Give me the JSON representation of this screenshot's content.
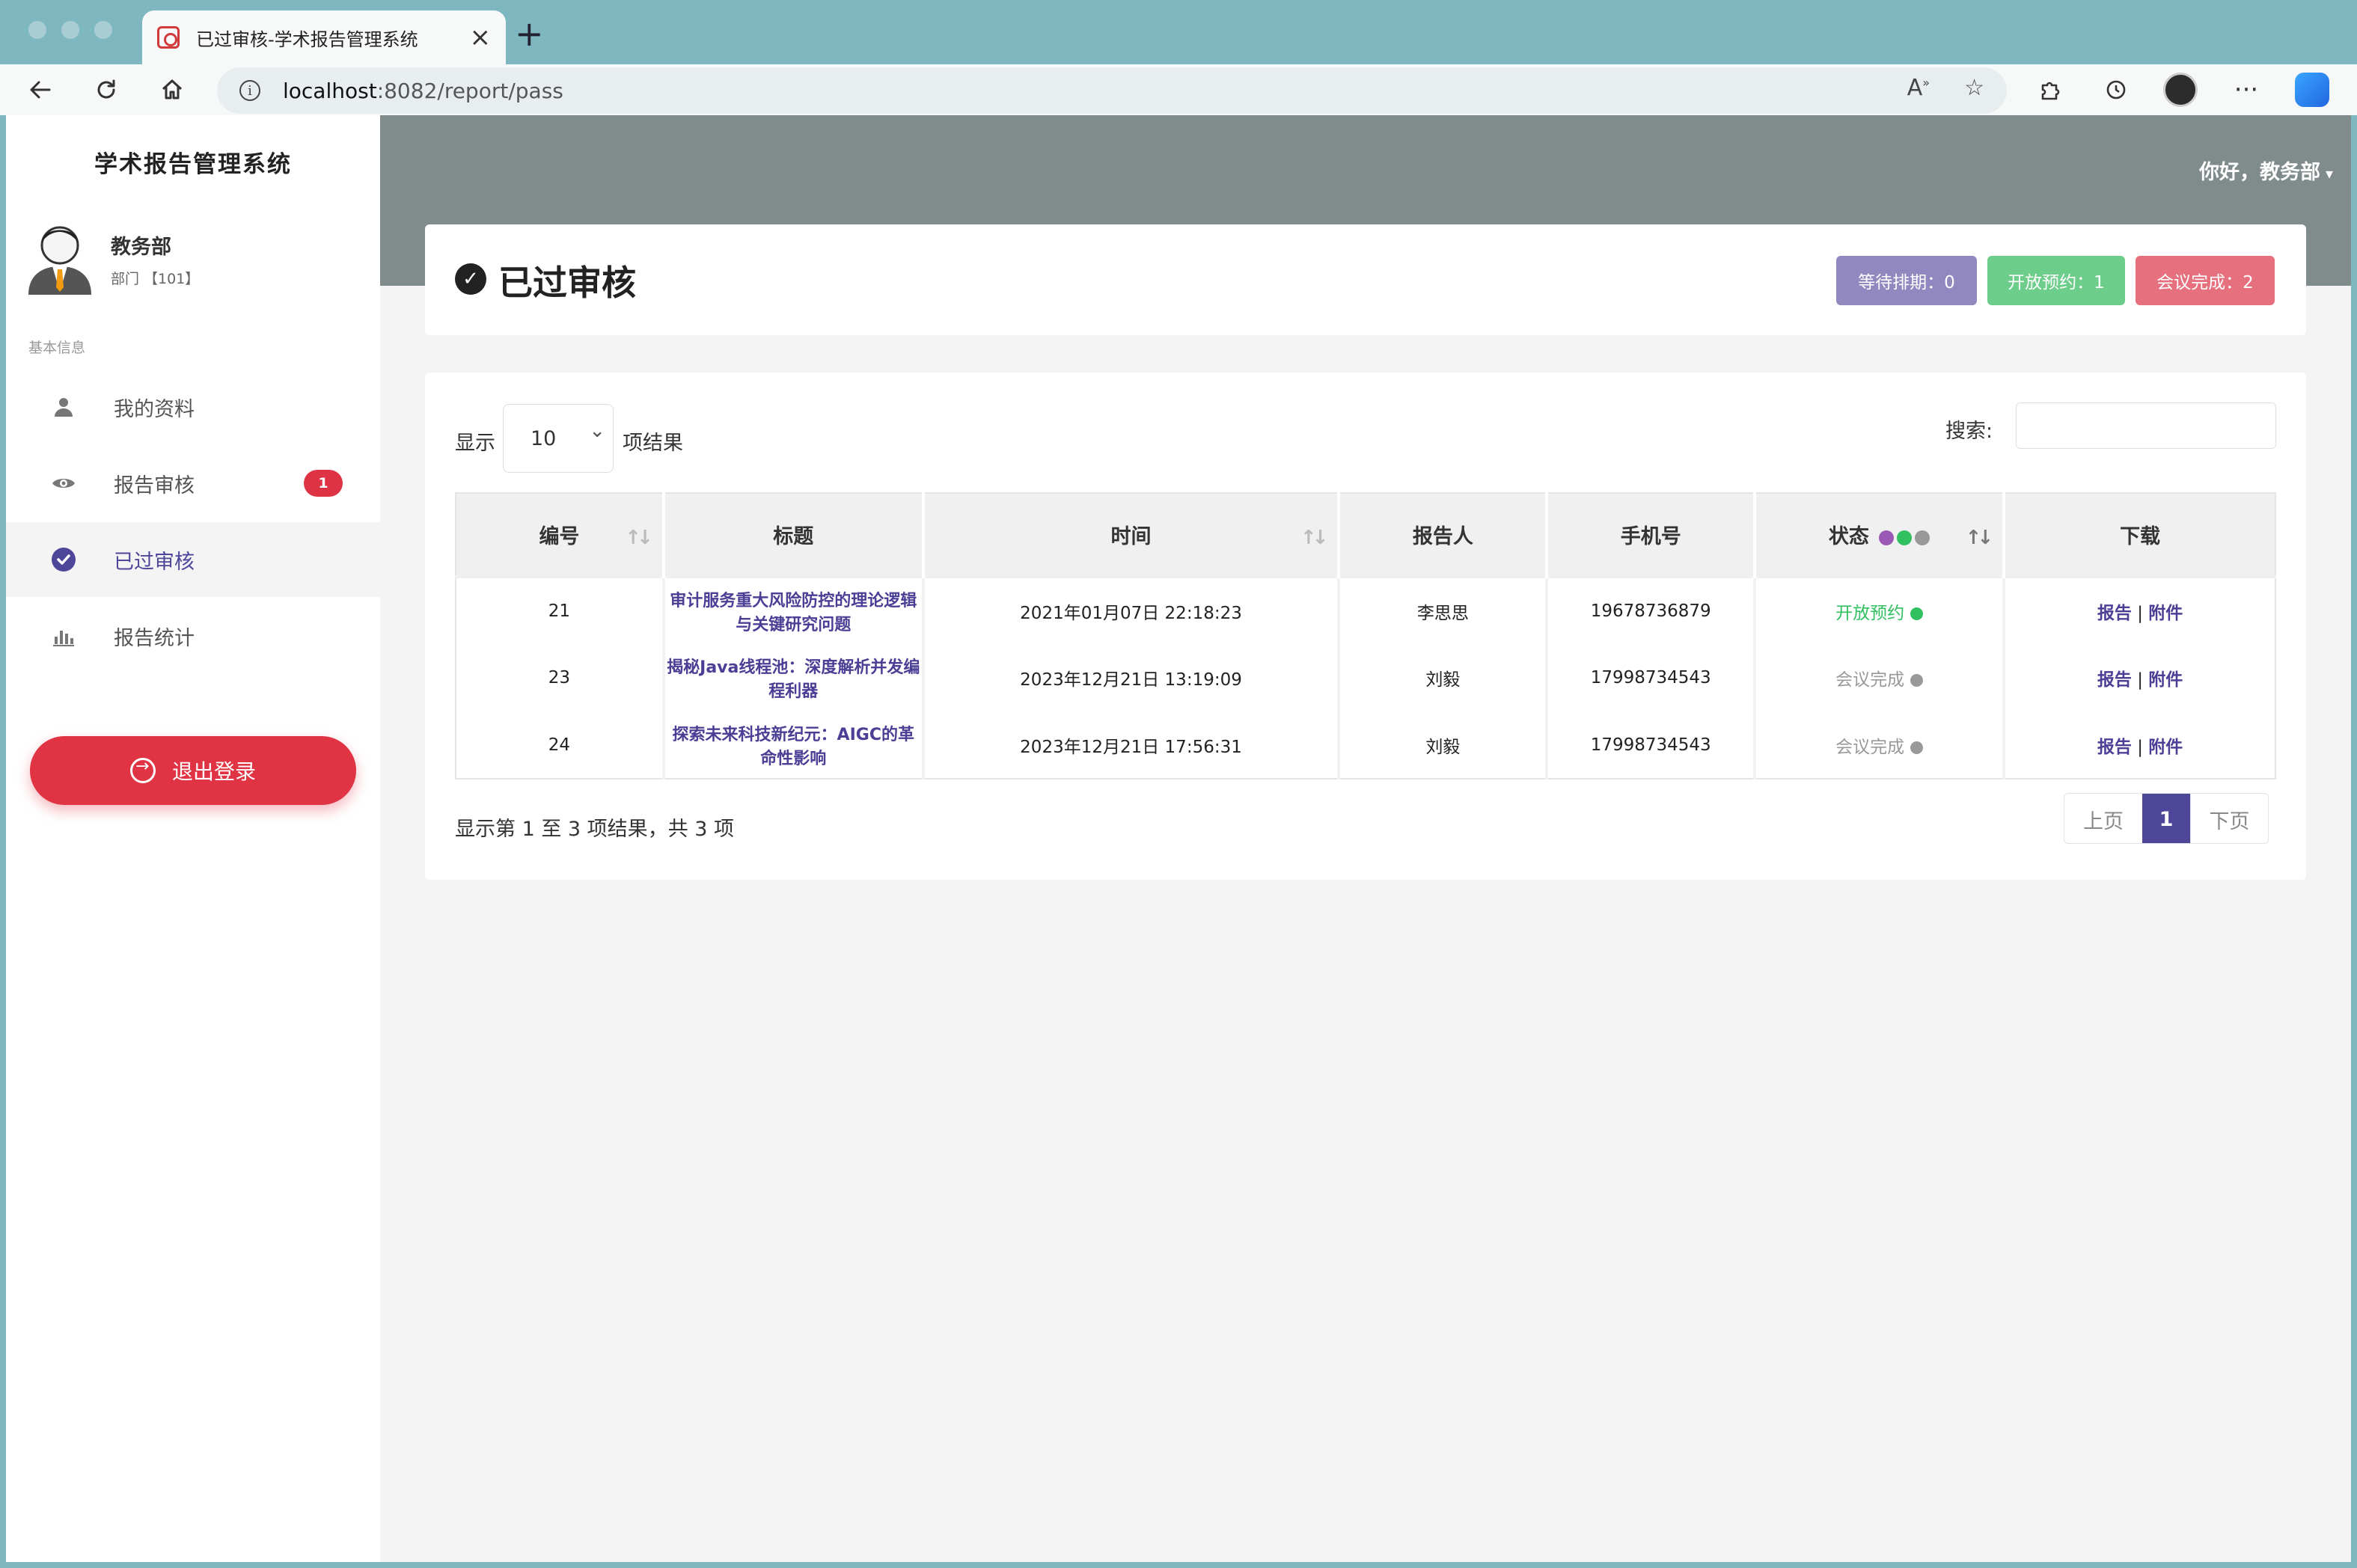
{
  "browser": {
    "tab_title": "已过审核-学术报告管理系统",
    "url_host": "localhost",
    "url_rest": ":8082/report/pass"
  },
  "sidebar": {
    "brand": "学术报告管理系统",
    "user_name": "教务部",
    "user_dept": "部门 【101】",
    "section_label": "基本信息",
    "items": [
      {
        "label": "我的资料",
        "icon": "user-icon"
      },
      {
        "label": "报告审核",
        "icon": "eye-icon",
        "badge": "1"
      },
      {
        "label": "已过审核",
        "icon": "check-circle-icon",
        "active": true
      },
      {
        "label": "报告统计",
        "icon": "bar-chart-icon"
      }
    ],
    "logout_label": "退出登录"
  },
  "header": {
    "greeting": "你好，教务部"
  },
  "page": {
    "title": "已过审核",
    "stats": {
      "waiting": "等待排期：0",
      "open": "开放预约：1",
      "done": "会议完成：2"
    }
  },
  "table": {
    "show_label": "显示",
    "page_length": "10",
    "results_label": "项结果",
    "search_label": "搜索:",
    "search_value": "",
    "columns": [
      "编号",
      "标题",
      "时间",
      "报告人",
      "手机号",
      "状态",
      "下载"
    ],
    "rows": [
      {
        "id": "21",
        "title": "审计服务重大风险防控的理论逻辑与关键研究问题",
        "time": "2021年01月07日 22:18:23",
        "speaker": "李思思",
        "phone": "19678736879",
        "status": "开放预约",
        "status_color": "#30c060",
        "dl_report": "报告",
        "dl_sep": "|",
        "dl_attach": "附件"
      },
      {
        "id": "23",
        "title": "揭秘Java线程池：深度解析并发编程利器",
        "time": "2023年12月21日 13:19:09",
        "speaker": "刘毅",
        "phone": "17998734543",
        "status": "会议完成",
        "status_color": "#999999",
        "dl_report": "报告",
        "dl_sep": "|",
        "dl_attach": "附件"
      },
      {
        "id": "24",
        "title": "探索未来科技新纪元：AIGC的革命性影响",
        "time": "2023年12月21日 17:56:31",
        "speaker": "刘毅",
        "phone": "17998734543",
        "status": "会议完成",
        "status_color": "#999999",
        "dl_report": "报告",
        "dl_sep": "|",
        "dl_attach": "附件"
      }
    ],
    "status_legend_colors": [
      "#9b59b6",
      "#30c060",
      "#999999"
    ],
    "info": "显示第 1 至 3 项结果，共 3 项",
    "pager": {
      "prev": "上页",
      "current": "1",
      "next": "下页"
    }
  },
  "colors": {
    "accent": "#4e4699",
    "danger": "#e03444",
    "topbar": "#808c8c"
  }
}
